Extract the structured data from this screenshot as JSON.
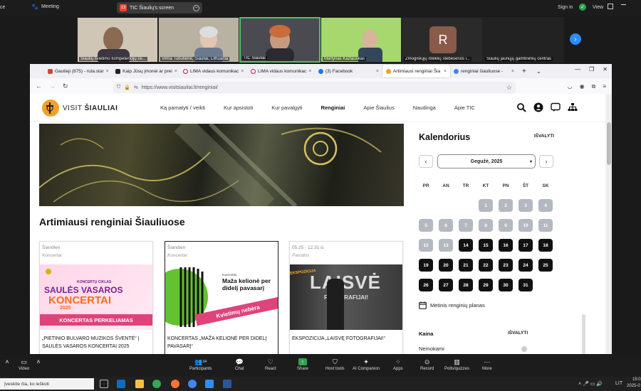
{
  "zoom_top": {
    "left_fragment": "ce",
    "meeting_label": "Meeting",
    "share_badge": "13",
    "share_label": "TIC Šiaulių's screen",
    "signin": "Sign in",
    "view": "View"
  },
  "participants": [
    {
      "name": "Šiaulių švietimo kompetencijų ce..."
    },
    {
      "name": "Vilma Tubutiene, Šiauliai, Lithuania"
    },
    {
      "name": "TIC Šiauliai"
    },
    {
      "name": "Martynas Kazlauskas"
    },
    {
      "name": "Žmogiškųjų išteklių stebėsenos i...",
      "initial": "R"
    },
    {
      "name": "Šiaulių jaunųjų gamtininkų centras"
    }
  ],
  "browser": {
    "tabs": [
      {
        "label": "Gautieji (875) - ruta.star",
        "color": "#d44638"
      },
      {
        "label": "Kaip Jūsų įmonei ar prei",
        "color": "#222222"
      },
      {
        "label": "LIMA vidaus komunikac",
        "color": "#c2185b"
      },
      {
        "label": "LIMA vidaus komunikac",
        "color": "#c2185b"
      },
      {
        "label": "(3) Facebook",
        "color": "#1877f2"
      },
      {
        "label": "Artimiausi renginiai Šia",
        "color": "#f0a12a"
      },
      {
        "label": "renginiai šiauliuose - ",
        "color": "#4285f4"
      }
    ],
    "url": "https://www.visitsiauliai.lt/renginiai/"
  },
  "site": {
    "logo_pre": "VISIT",
    "logo_bold": "ŠIAULIAI",
    "nav": [
      "Ką pamatyti / veikti",
      "Kur apsistoti",
      "Kur pavalgyti",
      "Renginiai",
      "Apie Šiaulius",
      "Naudinga",
      "Apie TIC"
    ],
    "section_title": "Artimiausi renginiai Šiauliuose",
    "cards": [
      {
        "date": "Šiandien",
        "category": "Koncertai",
        "img_top": "KONCERTŲ CIKLAS",
        "img_main1": "SAULĖS VASAROS",
        "img_main2": "KONCERTAI",
        "img_year": "2025",
        "img_banner": "KONCERTAS PERKELIAMAS",
        "title": "„PIETINIO BULVARO MUZIKOS ŠVENTĖ“ | SAULĖS VASAROS KONCERTAI 2025"
      },
      {
        "date": "Šiandien",
        "category": "Koncertai",
        "img_small": "Koncertas",
        "img_main": "Maža kelionė per didelį pavasarį",
        "img_banner": "Kvietimų nebėra",
        "title": "KONCERTAS „MAŽA KELIONĖ PER DIDELĮ PAVASARĮ“"
      },
      {
        "date": "05.25 - 12.31 d.",
        "category": "Parodos",
        "img_left": "EKSPOZICIJA",
        "img_main": "LAISVĖ",
        "img_sub": "FOTOGRAFIJAI!",
        "title": "EKSPOZICIJA „LAISVĘ FOTOGRAFIJAI!“"
      }
    ]
  },
  "calendar": {
    "title": "Kalendorius",
    "clear": "IŠVALYTI",
    "month": "Gegužė, 2025",
    "weekdays": [
      "PR",
      "AN",
      "TR",
      "KT",
      "PN",
      "ŠT",
      "SK"
    ],
    "first_weekday_index": 3,
    "days_in_month": 31,
    "today": 14,
    "plan_label": "Metinis renginių planas",
    "price_label": "Kaina",
    "price_clear": "IŠVALYTI",
    "free_label": "Nemokami"
  },
  "zoom_toolbar": {
    "video": "Video",
    "participants": "Participants",
    "participants_count": "14",
    "chat": "Chat",
    "react": "React",
    "share": "Share",
    "host_tools": "Host tools",
    "ai": "AI Companion",
    "apps": "Apps",
    "record": "Record",
    "polls": "Polls/quizzes",
    "more": "More"
  },
  "taskbar": {
    "search": "Įveskite čia, ko ieškoti",
    "lang": "LIT",
    "time": "15:0",
    "date": "2025-0"
  },
  "colors": {
    "accent_orange": "#f0a12a",
    "zoom_green": "#4cc26a",
    "zoom_blue": "#2d8cff",
    "past_day": "#b4b8c0",
    "future_day": "#111111"
  }
}
